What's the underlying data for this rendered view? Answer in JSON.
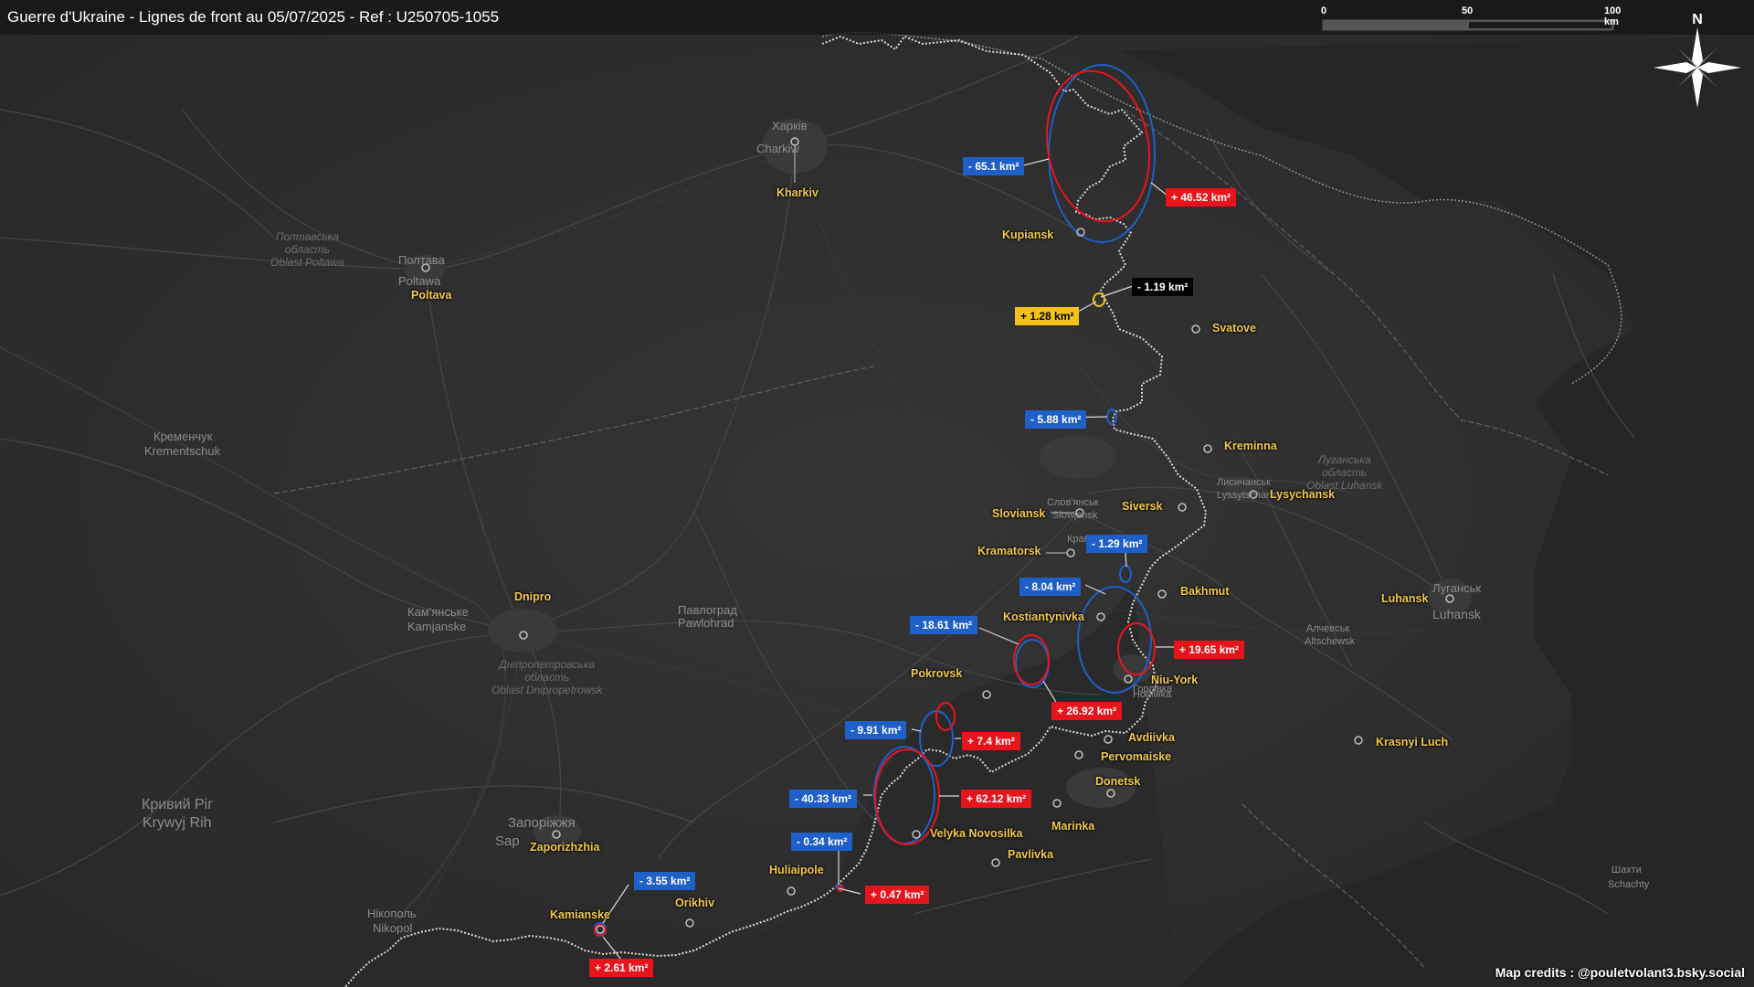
{
  "title": "Guerre d'Ukraine - Lignes de front au 05/07/2025 - Ref : U250705-1055",
  "credits": "Map credits : @pouletvolant3.bsky.social",
  "scale_bar": {
    "labels": [
      "0",
      "50",
      "100 km"
    ]
  },
  "compass": {
    "label": "N",
    "icon": "compass-rose-icon"
  },
  "colors": {
    "gain_red": "#e8141c",
    "loss_blue": "#1f5fc8",
    "frontline": "#d9d9d9",
    "city_label": "#f2c94c"
  },
  "cities": [
    {
      "name": "Kharkiv"
    },
    {
      "name": "Kupiansk"
    },
    {
      "name": "Svatove"
    },
    {
      "name": "Poltava"
    },
    {
      "name": "Kreminna"
    },
    {
      "name": "Lysychansk"
    },
    {
      "name": "Siversk"
    },
    {
      "name": "Sloviansk"
    },
    {
      "name": "Kramatorsk"
    },
    {
      "name": "Bakhmut"
    },
    {
      "name": "Kostiantynivka"
    },
    {
      "name": "Luhansk"
    },
    {
      "name": "Dnipro"
    },
    {
      "name": "Pokrovsk"
    },
    {
      "name": "Niu-York"
    },
    {
      "name": "Avdiivka"
    },
    {
      "name": "Pervomaiske"
    },
    {
      "name": "Donetsk"
    },
    {
      "name": "Marinka"
    },
    {
      "name": "Krasnyi Luch"
    },
    {
      "name": "Velyka Novosilka"
    },
    {
      "name": "Pavlivka"
    },
    {
      "name": "Zaporizhzhia"
    },
    {
      "name": "Huliaipole"
    },
    {
      "name": "Orikhiv"
    },
    {
      "name": "Kamianske"
    }
  ],
  "basemap_names": [
    "Харків",
    "Charkiw",
    "Полтава",
    "Poltawa",
    "Кременчук",
    "Krementschuk",
    "Павлоград",
    "Pawlohrad",
    "Кам'янське",
    "Kamjanske",
    "Кривий Ріг",
    "Krywyj Rih",
    "Запоріжжя",
    "Sap",
    "Нікополь",
    "Nikopol",
    "Слов'янськ",
    "Slowjansk",
    "Краматорськ",
    "Лисичанськ",
    "Lyssytschansk",
    "Луганськ",
    "Luhansk",
    "Алчевськ",
    "Altschewsk",
    "Горлівка",
    "Horliwka",
    "Шахти",
    "Schachty"
  ],
  "regions": [
    {
      "line1": "Полтавська",
      "line2": "область",
      "line3": "Oblast Poltawa"
    },
    {
      "line1": "Дніпропетровська",
      "line2": "область",
      "line3": "Oblast Dnipropetrowsk"
    },
    {
      "line1": "Луганська",
      "line2": "область",
      "line3": "Oblast Luhansk"
    }
  ],
  "area_changes": [
    {
      "label": "- 65.1 km²",
      "type": "loss"
    },
    {
      "label": "+ 46.52 km²",
      "type": "gain"
    },
    {
      "label": "- 1.19 km²",
      "type": "neutral"
    },
    {
      "label": "+ 1.28 km²",
      "type": "highlight"
    },
    {
      "label": "- 5.88 km²",
      "type": "loss"
    },
    {
      "label": "- 1.29 km²",
      "type": "loss"
    },
    {
      "label": "- 8.04 km²",
      "type": "loss"
    },
    {
      "label": "+ 19.65 km²",
      "type": "gain"
    },
    {
      "label": "- 18.61 km²",
      "type": "loss"
    },
    {
      "label": "+ 26.92 km²",
      "type": "gain"
    },
    {
      "label": "- 9.91 km²",
      "type": "loss"
    },
    {
      "label": "+ 7.4 km²",
      "type": "gain"
    },
    {
      "label": "- 40.33 km²",
      "type": "loss"
    },
    {
      "label": "+ 62.12 km²",
      "type": "gain"
    },
    {
      "label": "- 0.34 km²",
      "type": "loss"
    },
    {
      "label": "+ 0.47 km²",
      "type": "gain"
    },
    {
      "label": "- 3.55 km²",
      "type": "loss"
    },
    {
      "label": "+ 2.61 km²",
      "type": "gain"
    }
  ]
}
